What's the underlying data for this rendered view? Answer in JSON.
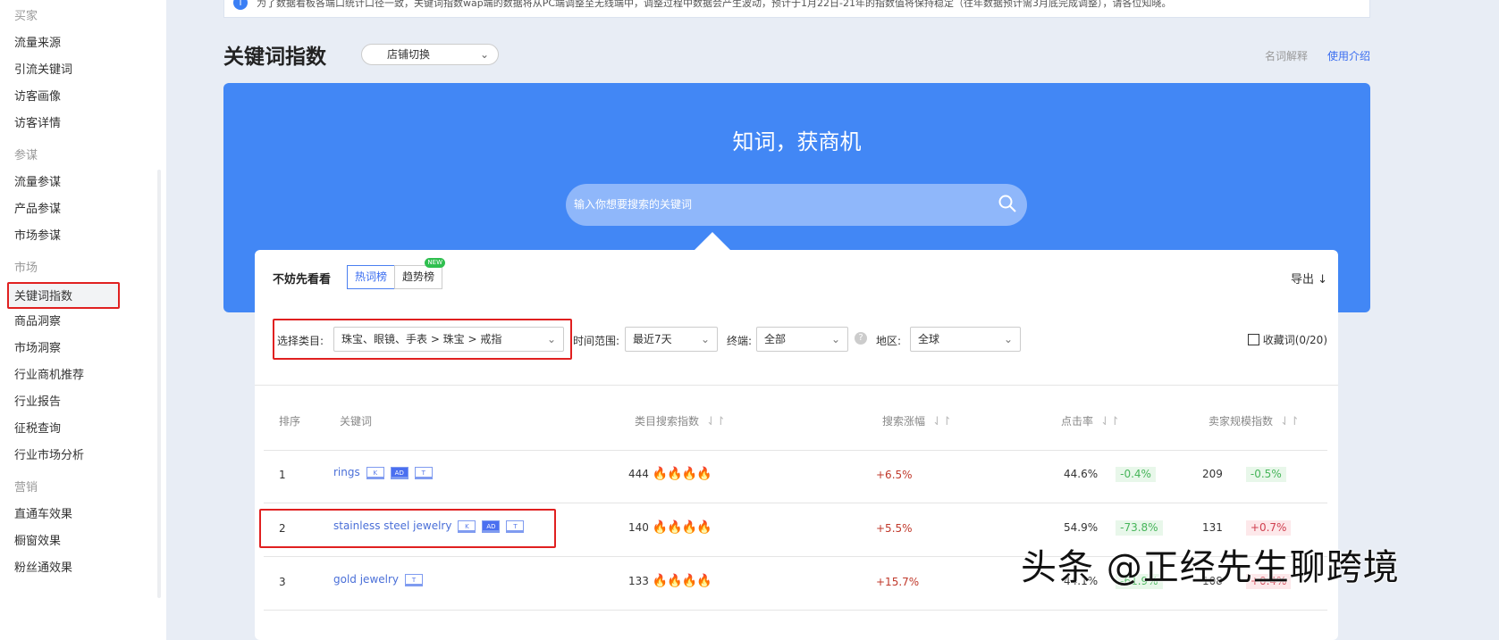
{
  "sidebar": {
    "groups": [
      {
        "title": "买家",
        "items": [
          "流量来源",
          "引流关键词",
          "访客画像",
          "访客详情"
        ]
      },
      {
        "title": "参谋",
        "items": [
          "流量参谋",
          "产品参谋",
          "市场参谋"
        ]
      },
      {
        "title": "市场",
        "items": [
          "关键词指数",
          "商品洞察",
          "市场洞察",
          "行业商机推荐",
          "行业报告",
          "征税查询",
          "行业市场分析"
        ]
      },
      {
        "title": "营销",
        "items": [
          "直通车效果",
          "橱窗效果",
          "粉丝通效果"
        ]
      }
    ],
    "active": "关键词指数"
  },
  "notice": "为了数据看板各端口统计口径一致，关键词指数wap端的数据将从PC端调整至无线端中，调整过程中数据会产生波动，预计于1月22日-21年的指数值将保持稳定（往年数据预计需3月底完成调整），请各位知晓。",
  "page": {
    "title": "关键词指数",
    "shop_switch": "店铺切换",
    "glossary": "名词解释",
    "guide": "使用介绍"
  },
  "hero": {
    "slogan": "知词，获商机",
    "search_placeholder": "输入你想要搜索的关键词"
  },
  "panel": {
    "intro": "不妨先看看",
    "tabs": [
      "热词榜",
      "趋势榜"
    ],
    "new_badge": "NEW",
    "export": "导出",
    "filters": {
      "category_label": "选择类目:",
      "category_value": "珠宝、眼镜、手表 > 珠宝 > 戒指",
      "time_label": "时间范围:",
      "time_value": "最近7天",
      "terminal_label": "终端:",
      "terminal_value": "全部",
      "region_label": "地区:",
      "region_value": "全球",
      "favorites": "收藏词(0/20)"
    }
  },
  "table": {
    "headers": [
      "排序",
      "关键词",
      "类目搜索指数",
      "搜索涨幅",
      "点击率",
      "卖家规模指数"
    ],
    "rows": [
      {
        "rank": "1",
        "keyword": "rings",
        "tags": [
          "K",
          "AD",
          "T"
        ],
        "search_index": "444",
        "growth": "+6.5%",
        "ctr": "44.6%",
        "ctr_change": "-0.4%",
        "seller_index": "209",
        "seller_change": "-0.5%"
      },
      {
        "rank": "2",
        "keyword": "stainless steel jewelry",
        "tags": [
          "K",
          "AD",
          "T"
        ],
        "search_index": "140",
        "growth": "+5.5%",
        "ctr": "54.9%",
        "ctr_change": "-73.8%",
        "seller_index": "131",
        "seller_change": "+0.7%"
      },
      {
        "rank": "3",
        "keyword": "gold jewelry",
        "tags": [
          "T"
        ],
        "search_index": "133",
        "growth": "+15.7%",
        "ctr": "44.1%",
        "ctr_change": "-61.9%",
        "seller_index": "108",
        "seller_change": "+0.4%"
      }
    ]
  },
  "watermark": "头条 @正经先生聊跨境"
}
